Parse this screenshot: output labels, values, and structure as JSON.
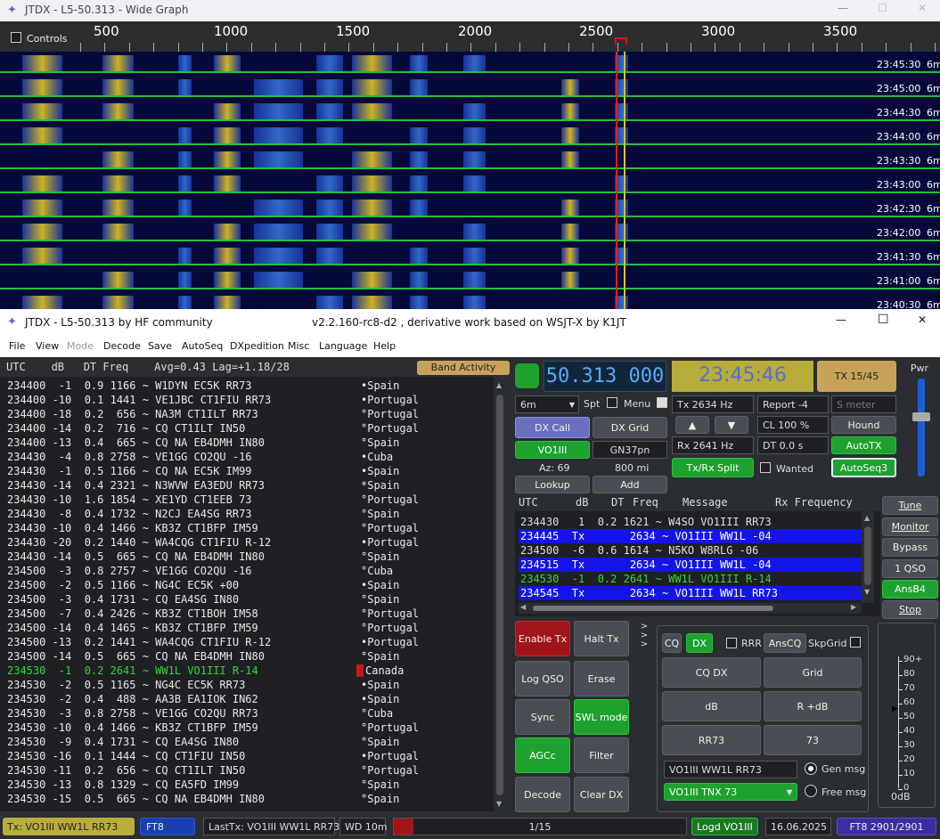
{
  "wide_graph": {
    "title": "JTDX - L5-50.313 - Wide Graph",
    "controls_label": "Controls",
    "scale_labels": [
      "500",
      "1000",
      "1500",
      "2000",
      "2500",
      "3000",
      "3500"
    ],
    "timestamps": [
      "23:45:30",
      "23:45:00",
      "23:44:30",
      "23:44:00",
      "23:43:30",
      "23:43:00",
      "23:42:30",
      "23:42:00",
      "23:41:30",
      "23:41:00",
      "23:40:30"
    ],
    "band": "6m"
  },
  "main": {
    "title": "JTDX - L5-50.313  by HF community",
    "subtitle": "v2.2.160-rc8-d2 , derivative work based on WSJT-X by K1JT",
    "menu": [
      "File",
      "View",
      "Mode",
      "Decode",
      "Save",
      "AutoSeq",
      "DXpedition",
      "Misc",
      "Language",
      "Help"
    ]
  },
  "band_activity": {
    "header": "UTC    dB   DT Freq    Avg=0.43 Lag=+1.18/28",
    "button": "Band Activity",
    "rows": [
      {
        "text": "234400  -1  0.9 1166 ~ W1DYN EC5K RR73",
        "country": "•Spain"
      },
      {
        "text": "234400 -10  0.1 1441 ~ VE1JBC CT1FIU RR73",
        "country": "•Portugal"
      },
      {
        "text": "234400 -18  0.2  656 ~ NA3M CT1ILT RR73",
        "country": "°Portugal"
      },
      {
        "text": "234400 -14  0.2  716 ~ CQ CT1ILT IN50",
        "country": "°Portugal"
      },
      {
        "text": "234400 -13  0.4  665 ~ CQ NA EB4DMH IN80",
        "country": "°Spain"
      },
      {
        "text": "234430  -4  0.8 2758 ~ VE1GG CO2QU -16",
        "country": "•Cuba"
      },
      {
        "text": "234430  -1  0.5 1166 ~ CQ NA EC5K IM99",
        "country": "•Spain"
      },
      {
        "text": "234430 -14  0.4 2321 ~ N3WVW EA3EDU RR73",
        "country": "*Spain"
      },
      {
        "text": "234430 -10  1.6 1854 ~ XE1YD CT1EEB 73",
        "country": "°Portugal"
      },
      {
        "text": "234430  -8  0.4 1732 ~ N2CJ EA4SG RR73",
        "country": "°Spain"
      },
      {
        "text": "234430 -10  0.4 1466 ~ KB3Z CT1BFP IM59",
        "country": "°Portugal"
      },
      {
        "text": "234430 -20  0.2 1440 ~ WA4CQG CT1FIU R-12",
        "country": "•Portugal"
      },
      {
        "text": "234430 -14  0.5  665 ~ CQ NA EB4DMH IN80",
        "country": "°Spain"
      },
      {
        "text": "234500  -3  0.8 2757 ~ VE1GG CO2QU -16",
        "country": "°Cuba"
      },
      {
        "text": "234500  -2  0.5 1166 ~ NG4C EC5K +00",
        "country": "•Spain"
      },
      {
        "text": "234500  -3  0.4 1731 ~ CQ EA4SG IN80",
        "country": "°Spain"
      },
      {
        "text": "234500  -7  0.4 2426 ~ KB3Z CT1BOH IM58",
        "country": "°Portugal"
      },
      {
        "text": "234500 -14  0.4 1465 ~ KB3Z CT1BFP IM59",
        "country": "°Portugal"
      },
      {
        "text": "234500 -13  0.2 1441 ~ WA4CQG CT1FIU R-12",
        "country": "•Portugal"
      },
      {
        "text": "234500 -14  0.5  665 ~ CQ NA EB4DMH IN80",
        "country": "°Spain"
      },
      {
        "text": "234530  -1  0.2 2641 ~ WW1L VO1III R-14",
        "country": "Canada",
        "highlight": true
      },
      {
        "text": "234530  -2  0.5 1165 ~ NG4C EC5K RR73",
        "country": "•Spain"
      },
      {
        "text": "234530  -2  0.4  488 ~ AA3B EA1IOK IN62",
        "country": "•Spain"
      },
      {
        "text": "234530  -3  0.8 2758 ~ VE1GG CO2QU RR73",
        "country": "°Cuba"
      },
      {
        "text": "234530 -10  0.4 1466 ~ KB3Z CT1BFP IM59",
        "country": "°Portugal"
      },
      {
        "text": "234530  -9  0.4 1731 ~ CQ EA4SG IN80",
        "country": "°Spain"
      },
      {
        "text": "234530 -16  0.1 1444 ~ CQ CT1FIU IN50",
        "country": "•Portugal"
      },
      {
        "text": "234530 -11  0.2  656 ~ CQ CT1ILT IN50",
        "country": "°Portugal"
      },
      {
        "text": "234530 -13  0.8 1329 ~ CQ EA5FD IM99",
        "country": "°Spain"
      },
      {
        "text": "234530 -15  0.5  665 ~ CQ NA EB4DMH IN80",
        "country": "°Spain"
      }
    ]
  },
  "controls": {
    "frequency": "50.313 000",
    "clock": "23:45:46",
    "tx_period": "TX 15/45",
    "band_select": "6m",
    "spt": "Spt",
    "menu": "Menu",
    "dx_call_btn": "DX Call",
    "dx_grid_btn": "DX Grid",
    "dx_call": "VO1III",
    "dx_grid": "GN37pn",
    "az": "Az: 69",
    "dist": "800 mi",
    "lookup": "Lookup",
    "add": "Add",
    "tx_freq": "Tx  2634  Hz",
    "rx_freq": "Rx  2641  Hz",
    "report": "Report -4",
    "smeter": "S meter",
    "cl": "CL  100 %",
    "dt": "DT  0.0 s",
    "hound": "Hound",
    "autotx": "AutoTX",
    "autoseq3": "AutoSeq3",
    "txrx_split": "Tx/Rx Split",
    "wanted": "Wanted",
    "pwr": "Pwr"
  },
  "rx_list": {
    "header": [
      "UTC",
      "dB",
      "DT",
      "Freq",
      "Message",
      "Rx Frequency"
    ],
    "rows": [
      {
        "text": "234430   1  0.2 1621 ~ W4SO VO1III RR73",
        "style": "plain"
      },
      {
        "text": "234445  Tx       2634 ~ VO1III WW1L -04",
        "style": "tx"
      },
      {
        "text": "234500  -6  0.6 1614 ~ N5KO W8RLG -06",
        "style": "plain"
      },
      {
        "text": "234515  Tx       2634 ~ VO1III WW1L -04",
        "style": "tx"
      },
      {
        "text": "234530  -1  0.2 2641 ~ WW1L VO1III R-14",
        "style": "green"
      },
      {
        "text": "234545  Tx       2634 ~ VO1III WW1L RR73",
        "style": "tx"
      }
    ]
  },
  "side_buttons": [
    "Tune",
    "Monitor",
    "Bypass",
    "1 QSO",
    "AnsB4",
    "Stop"
  ],
  "left_buttons": {
    "enable_tx": "Enable Tx",
    "halt_tx": "Halt Tx",
    "log_qso": "Log QSO",
    "erase": "Erase",
    "sync": "Sync",
    "swl_mode": "SWL mode",
    "agcc": "AGCc",
    "filter": "Filter",
    "decode": "Decode",
    "clear_dx": "Clear DX"
  },
  "msg_panel": {
    "cq": "CQ",
    "dx": "DX",
    "rrr": "RRR",
    "anscq": "AnsCQ",
    "skpgrid": "SkpGrid",
    "cq_dx": "CQ DX",
    "grid": "Grid",
    "db": "dB",
    "r_db": "R +dB",
    "rr73": "RR73",
    "n73": "73",
    "gen_msg_text": "VO1III WW1L RR73",
    "gen_msg": "Gen msg",
    "free_msg_text": "VO1III TNX 73",
    "free_msg": "Free msg"
  },
  "meter": {
    "labels": [
      "90+",
      "80",
      "70",
      "60",
      "50",
      "40",
      "30",
      "20",
      "10",
      "0"
    ],
    "bottom": "0dB"
  },
  "status": {
    "tx": "Tx: VO1III WW1L RR73",
    "mode": "FT8",
    "last_tx": "LastTx: VO1III WW1L RR73",
    "wd": "WD 10m",
    "progress": "1/15",
    "progress_fraction": 0.067,
    "logd": "Logd VO1III",
    "date": "16.06.2025",
    "ft8count": "FT8  2901/2901"
  }
}
